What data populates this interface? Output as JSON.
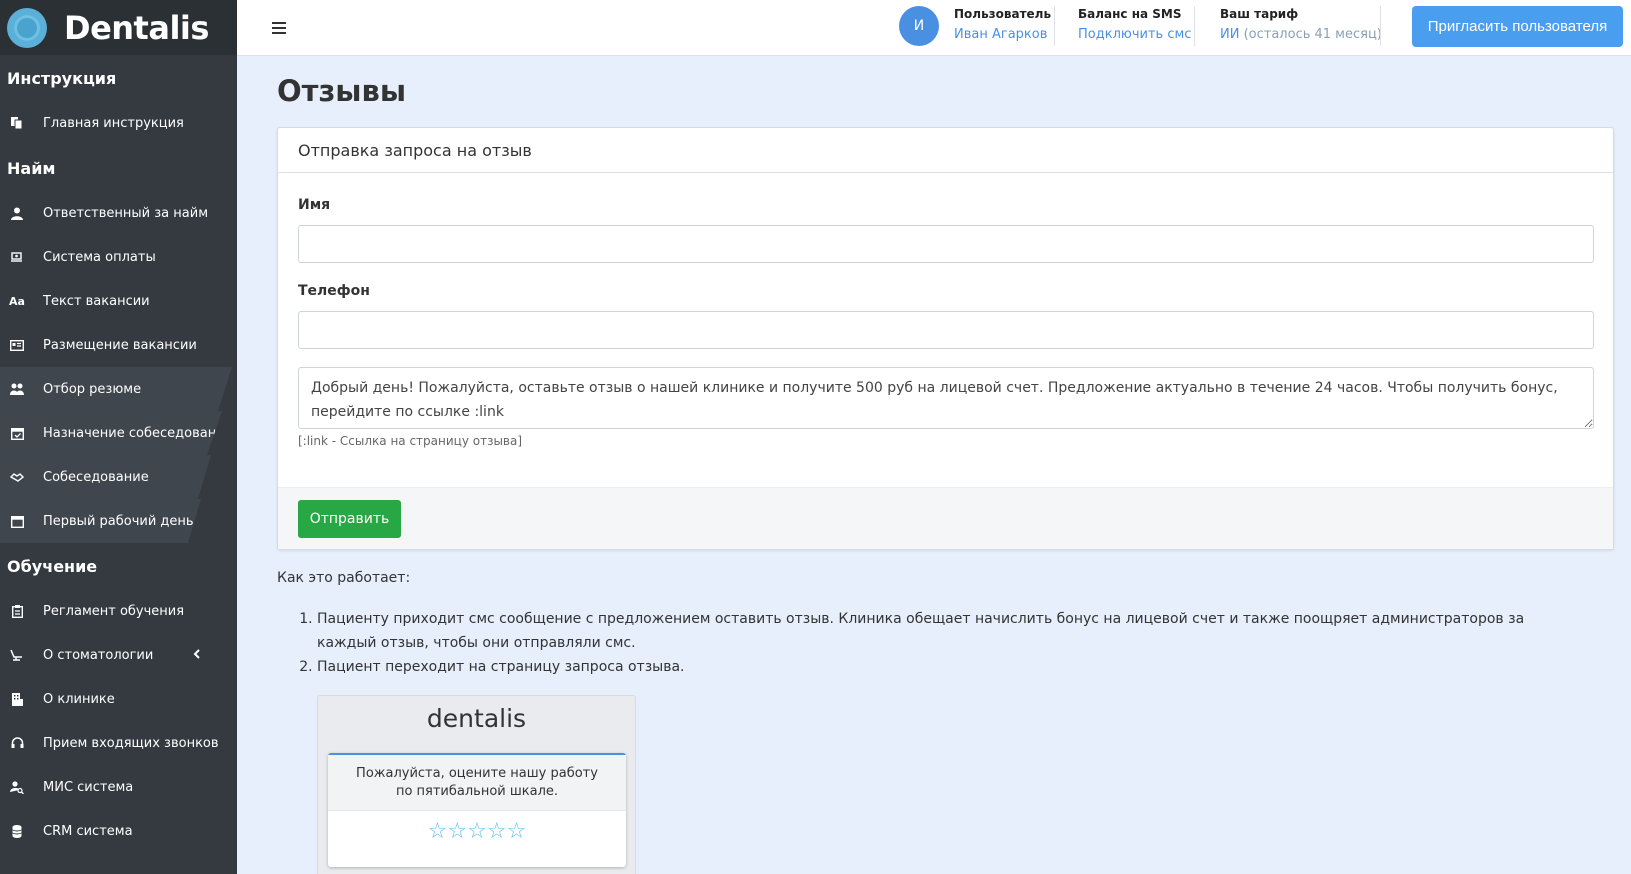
{
  "brand": {
    "name": "Dentalis"
  },
  "sidebar": {
    "sections": [
      {
        "title": "Инструкция",
        "items": [
          {
            "label": "Главная инструкция",
            "icon": "copy-icon"
          }
        ]
      },
      {
        "title": "Найм",
        "items": [
          {
            "label": "Ответственный за найм",
            "icon": "user-tie-icon"
          },
          {
            "label": "Система оплаты",
            "icon": "money-exchange-icon"
          },
          {
            "label": "Текст вакансии",
            "icon": "font-icon",
            "glyph": "Aa"
          },
          {
            "label": "Размещение вакансии",
            "icon": "id-card-icon"
          },
          {
            "label": "Отбор резюме",
            "icon": "users-icon"
          },
          {
            "label": "Назначение собеседования",
            "icon": "calendar-check-icon"
          },
          {
            "label": "Собеседование",
            "icon": "handshake-icon"
          },
          {
            "label": "Первый рабочий день",
            "icon": "calendar-icon"
          }
        ]
      },
      {
        "title": "Обучение",
        "items": [
          {
            "label": "Регламент обучения",
            "icon": "clipboard-icon"
          },
          {
            "label": "О стоматологии",
            "icon": "dental-chair-icon"
          },
          {
            "label": "О клинике",
            "icon": "building-icon"
          },
          {
            "label": "Прием входящих звонков",
            "icon": "headset-icon"
          },
          {
            "label": "МИС система",
            "icon": "user-search-icon"
          },
          {
            "label": "CRM система",
            "icon": "database-icon"
          }
        ]
      }
    ]
  },
  "header": {
    "avatar_letter": "И",
    "user_label": "Пользователь",
    "user_name": "Иван Агарков",
    "sms_label": "Баланс на SMS",
    "sms_link": "Подключить смс",
    "tariff_label": "Ваш тариф",
    "tariff_value": "ИИ",
    "tariff_remaining": "(осталось 41 месяц)",
    "invite_button": "Пригласить пользователя"
  },
  "page": {
    "title": "Отзывы",
    "card_title": "Отправка запроса на отзыв",
    "name_label": "Имя",
    "name_value": "",
    "phone_label": "Телефон",
    "phone_value": "",
    "message_text": "Добрый день! Пожалуйста, оставьте отзыв о нашей клинике и получите 500 руб на лицевой счет. Предложение актуально в течение 24 часов. Чтобы получить бонус, перейдите по ссылке :link",
    "hint": "[:link - Ссылка на страницу отзыва]",
    "submit_button": "Отправить",
    "how_title": "Как это работает:",
    "steps": [
      "Пациенту приходит смс сообщение с предложением оставить отзыв. Клиника обещает начислить бонус на лицевой счет и также поощряет администраторов за каждый отзыв, чтобы они отправляли смс.",
      "Пациент переходит на страницу запроса отзыва."
    ]
  },
  "preview": {
    "brand": "dentalis",
    "prompt": "Пожалуйста, оцените нашу работу по пятибальной шкале.",
    "stars_total": 5,
    "stars_filled": 0,
    "star_color": "#5bc2e7"
  }
}
